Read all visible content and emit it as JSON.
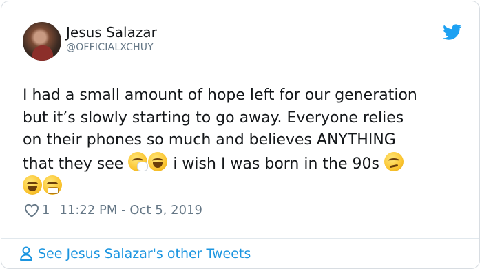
{
  "tweet": {
    "author_name": "Jesus Salazar",
    "author_handle": "@OFFICIALXCHUY",
    "lines": [
      "I had a small amount of hope left for our generation",
      "but it’s slowly starting to go away. Everyone relies",
      "on their phones so much and believes ANYTHING"
    ],
    "line4_text": "that they see",
    "line4_tail": "i wish I was born in the 90s",
    "like_count": "1",
    "timestamp": "11:22 PM - Oct 5, 2019",
    "brand_color": "#1da1f2",
    "icons": [
      "twitter-bird-icon",
      "heart-icon",
      "person-icon"
    ],
    "emojis_line4": [
      "sneezing-face-emoji",
      "tears-of-joy-emoji"
    ],
    "emoji_line4_end": "confused-face-emoji",
    "emojis_line5": [
      "tears-of-joy-emoji",
      "face-with-steam-emoji"
    ]
  },
  "footer": {
    "link_text": "See Jesus Salazar's other Tweets",
    "link_color": "#1b95e0"
  }
}
